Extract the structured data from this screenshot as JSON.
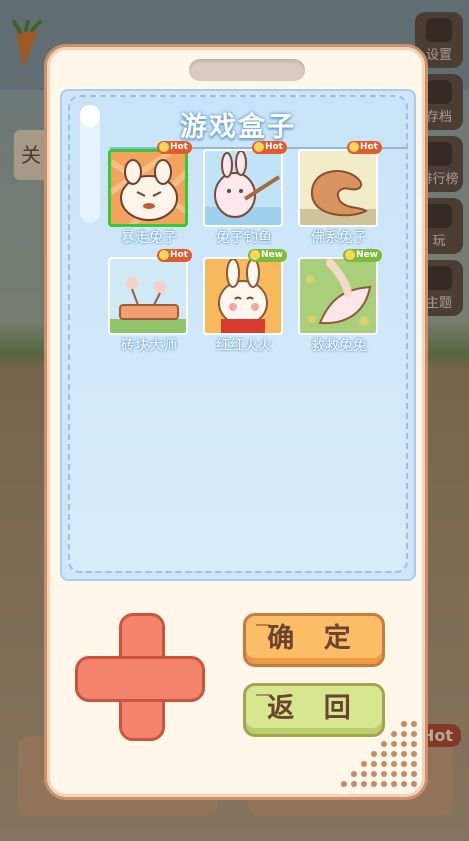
{
  "background": {
    "side_buttons": [
      "设置",
      "存档",
      "排行榜",
      "玩",
      "主题"
    ],
    "hot_label": "Hot",
    "left_tab": "关"
  },
  "device": {
    "title": "游戏盒子",
    "games": [
      {
        "name": "暴走兔子",
        "badge": "Hot",
        "selected": true
      },
      {
        "name": "兔子钓鱼",
        "badge": "Hot",
        "selected": false
      },
      {
        "name": "佛系兔子",
        "badge": "Hot",
        "selected": false
      },
      {
        "name": "砖块大师",
        "badge": "Hot",
        "selected": false
      },
      {
        "name": "红红火火",
        "badge": "New",
        "selected": false
      },
      {
        "name": "救救兔兔",
        "badge": "New",
        "selected": false
      }
    ],
    "confirm_label": "确 定",
    "back_label": "返 回"
  }
}
